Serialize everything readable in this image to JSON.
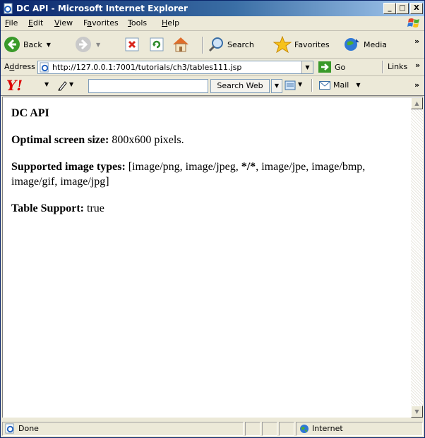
{
  "window": {
    "title": "DC API - Microsoft Internet Explorer",
    "controls": [
      "_",
      "□",
      "X"
    ]
  },
  "menu": {
    "items": [
      {
        "accel": "F",
        "rest": "ile"
      },
      {
        "accel": "E",
        "rest": "dit"
      },
      {
        "accel": "V",
        "rest": "iew"
      },
      {
        "pre": "F",
        "accel": "a",
        "rest": "vorites"
      },
      {
        "accel": "T",
        "rest": "ools"
      },
      {
        "accel": "H",
        "rest": "elp"
      }
    ]
  },
  "toolbar": {
    "back_label": "Back",
    "search_label": "Search",
    "favorites_label": "Favorites",
    "media_label": "Media",
    "overflow": "»"
  },
  "address": {
    "label_pre": "A",
    "label_accel": "d",
    "label_rest": "dress",
    "url": "http://127.0.0.1:7001/tutorials/ch3/tables111.jsp",
    "go_label": "Go",
    "links_label": "Links",
    "overflow": "»"
  },
  "yahoo": {
    "logo": "Y!",
    "search_value": "",
    "search_button": "Search Web",
    "mail_label": "Mail",
    "overflow": "»"
  },
  "page": {
    "heading": "DC API",
    "screen_size_label": "Optimal screen size:",
    "screen_size_value": "800x600 pixels.",
    "image_types_label": "Supported image types:",
    "image_types_value_a": "[image/png, image/jpeg, ",
    "image_types_value_bold": "*/*",
    "image_types_value_b": ", image/jpe, image/bmp, image/gif, image/jpg]",
    "table_support_label": "Table Support:",
    "table_support_value": "true"
  },
  "status": {
    "text": "Done",
    "zone": "Internet"
  }
}
